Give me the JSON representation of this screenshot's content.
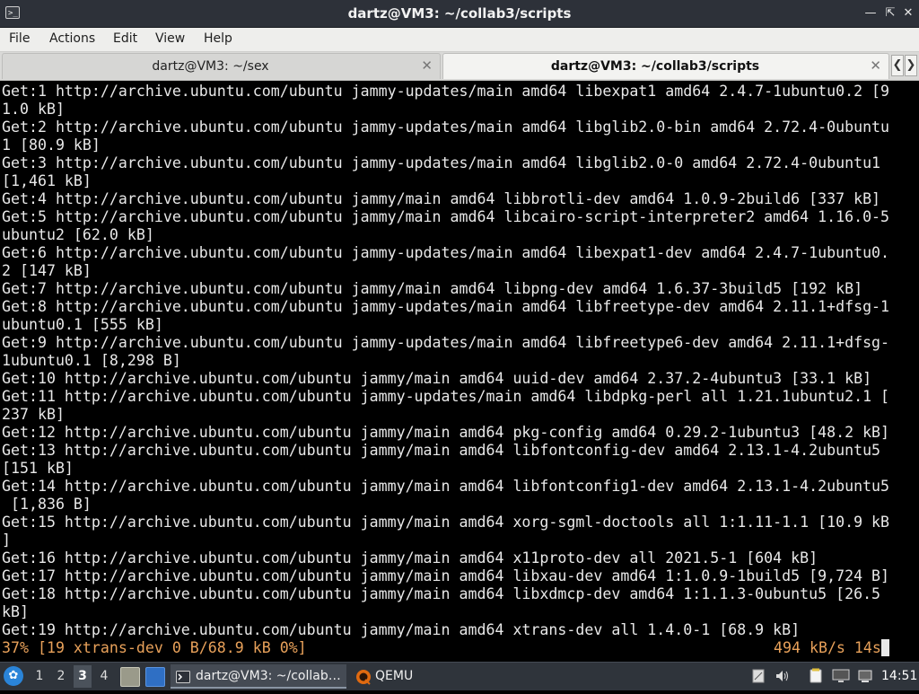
{
  "window": {
    "title": "dartz@VM3: ~/collab3/scripts",
    "controls": [
      "minimize-icon",
      "maximize-icon",
      "close-icon"
    ]
  },
  "menubar": {
    "items": [
      "File",
      "Actions",
      "Edit",
      "View",
      "Help"
    ]
  },
  "tabs": [
    {
      "label": "dartz@VM3: ~/sex",
      "active": false
    },
    {
      "label": "dartz@VM3: ~/collab3/scripts",
      "active": true
    }
  ],
  "terminal": {
    "lines": [
      "Get:1 http://archive.ubuntu.com/ubuntu jammy-updates/main amd64 libexpat1 amd64 2.4.7-1ubuntu0.2 [9",
      "1.0 kB]",
      "Get:2 http://archive.ubuntu.com/ubuntu jammy-updates/main amd64 libglib2.0-bin amd64 2.72.4-0ubuntu",
      "1 [80.9 kB]",
      "Get:3 http://archive.ubuntu.com/ubuntu jammy-updates/main amd64 libglib2.0-0 amd64 2.72.4-0ubuntu1",
      "[1,461 kB]",
      "Get:4 http://archive.ubuntu.com/ubuntu jammy/main amd64 libbrotli-dev amd64 1.0.9-2build6 [337 kB]",
      "Get:5 http://archive.ubuntu.com/ubuntu jammy/main amd64 libcairo-script-interpreter2 amd64 1.16.0-5",
      "ubuntu2 [62.0 kB]",
      "Get:6 http://archive.ubuntu.com/ubuntu jammy-updates/main amd64 libexpat1-dev amd64 2.4.7-1ubuntu0.",
      "2 [147 kB]",
      "Get:7 http://archive.ubuntu.com/ubuntu jammy/main amd64 libpng-dev amd64 1.6.37-3build5 [192 kB]",
      "Get:8 http://archive.ubuntu.com/ubuntu jammy-updates/main amd64 libfreetype-dev amd64 2.11.1+dfsg-1",
      "ubuntu0.1 [555 kB]",
      "Get:9 http://archive.ubuntu.com/ubuntu jammy-updates/main amd64 libfreetype6-dev amd64 2.11.1+dfsg-",
      "1ubuntu0.1 [8,298 B]",
      "Get:10 http://archive.ubuntu.com/ubuntu jammy/main amd64 uuid-dev amd64 2.37.2-4ubuntu3 [33.1 kB]",
      "Get:11 http://archive.ubuntu.com/ubuntu jammy-updates/main amd64 libdpkg-perl all 1.21.1ubuntu2.1 [",
      "237 kB]",
      "Get:12 http://archive.ubuntu.com/ubuntu jammy/main amd64 pkg-config amd64 0.29.2-1ubuntu3 [48.2 kB]",
      "Get:13 http://archive.ubuntu.com/ubuntu jammy/main amd64 libfontconfig-dev amd64 2.13.1-4.2ubuntu5",
      "[151 kB]",
      "Get:14 http://archive.ubuntu.com/ubuntu jammy/main amd64 libfontconfig1-dev amd64 2.13.1-4.2ubuntu5",
      " [1,836 B]",
      "Get:15 http://archive.ubuntu.com/ubuntu jammy/main amd64 xorg-sgml-doctools all 1:1.11-1.1 [10.9 kB",
      "]",
      "Get:16 http://archive.ubuntu.com/ubuntu jammy/main amd64 x11proto-dev all 2021.5-1 [604 kB]",
      "Get:17 http://archive.ubuntu.com/ubuntu jammy/main amd64 libxau-dev amd64 1:1.0.9-1build5 [9,724 B]",
      "Get:18 http://archive.ubuntu.com/ubuntu jammy/main amd64 libxdmcp-dev amd64 1:1.1.3-0ubuntu5 [26.5",
      "kB]",
      "Get:19 http://archive.ubuntu.com/ubuntu jammy/main amd64 xtrans-dev all 1.4.0-1 [68.9 kB]"
    ],
    "status_left": "37% [19 xtrans-dev 0 B/68.9 kB 0%]",
    "status_right": "494 kB/s 14s",
    "status_color": "#e8a15a"
  },
  "taskbar": {
    "workspaces": [
      "1",
      "2",
      "3",
      "4"
    ],
    "active_workspace": "3",
    "tasks": [
      {
        "label": "dartz@VM3: ~/collab…",
        "icon": "terminal-icon",
        "active": true
      },
      {
        "label": "QEMU",
        "icon": "qemu-icon",
        "active": false
      }
    ],
    "clock": "14:51"
  }
}
